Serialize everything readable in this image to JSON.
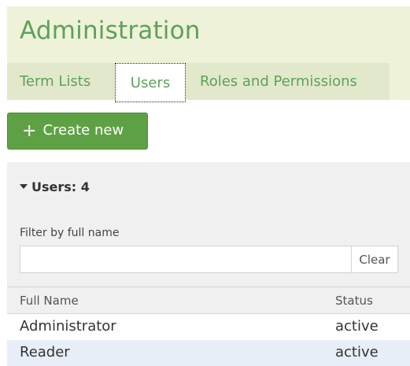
{
  "header": {
    "title": "Administration",
    "tabs": [
      {
        "label": "Term Lists"
      },
      {
        "label": "Users"
      },
      {
        "label": "Roles and Permissions"
      }
    ]
  },
  "toolbar": {
    "create_icon": "plus-icon",
    "create_label": "Create new"
  },
  "users_panel": {
    "summary_label": "Users: 4",
    "filter": {
      "label": "Filter by full name",
      "value": "",
      "clear_label": "Clear"
    },
    "table": {
      "columns": [
        "Full Name",
        "Status"
      ],
      "rows": [
        {
          "name": "Administrator",
          "status": "active"
        },
        {
          "name": "Reader",
          "status": "active"
        }
      ]
    }
  },
  "colors": {
    "accent_green": "#5ea15a",
    "button_green": "#5ea145",
    "header_bg": "#eef2d8",
    "tabs_bg": "#e2e8cc",
    "row_highlight": "#e8eef7"
  }
}
